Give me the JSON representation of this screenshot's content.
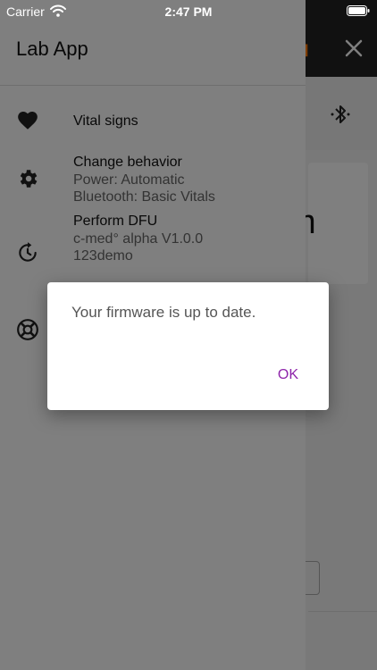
{
  "status_bar": {
    "carrier": "Carrier",
    "time": "2:47 PM"
  },
  "drawer": {
    "title": "Lab App",
    "items": [
      {
        "label": "Vital signs",
        "icon": "heart-icon"
      },
      {
        "label": "Change behavior",
        "icon": "gear-icon",
        "sub": [
          "Power: Automatic",
          "Bluetooth: Basic Vitals"
        ]
      },
      {
        "label": "Perform DFU",
        "icon": "refresh-icon",
        "sub": [
          "c-med° alpha V1.0.0",
          "123demo"
        ]
      },
      {
        "label": "",
        "icon": "lifebuoy-icon"
      }
    ]
  },
  "background_screen": {
    "card_text": "m",
    "accent_color": "#ff7a00"
  },
  "dialog": {
    "message": "Your firmware is up to date.",
    "ok_label": "OK",
    "ok_color": "#8e24aa"
  }
}
